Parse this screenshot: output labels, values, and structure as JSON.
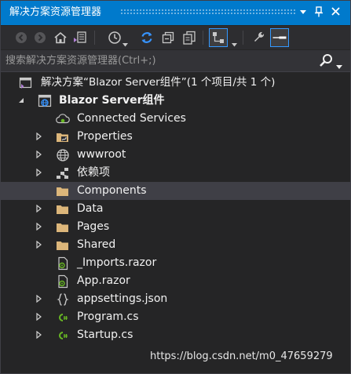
{
  "panel": {
    "title": "解决方案资源管理器",
    "controls": {
      "dropdown": "▼",
      "pin": "📌",
      "close": "✕"
    }
  },
  "toolbar": {
    "icons": [
      "back-icon",
      "forward-icon",
      "home-icon",
      "switch-views-icon",
      "pending-changes-filter-icon",
      "sync-icon",
      "collapse-all-icon",
      "show-all-files-icon",
      "properties-icon",
      "preview-icon"
    ]
  },
  "search": {
    "placeholder": "搜索解决方案资源管理器(Ctrl+;)",
    "value": ""
  },
  "tree": {
    "solution": "解决方案“Blazor Server组件”(1 个项目/共 1 个)",
    "project": "Blazor Server组件",
    "items": [
      {
        "label": "Connected Services",
        "icon": "connected-services-icon",
        "expandable": false
      },
      {
        "label": "Properties",
        "icon": "properties-folder-icon",
        "expandable": true
      },
      {
        "label": "wwwroot",
        "icon": "globe-icon",
        "expandable": true
      },
      {
        "label": "依赖项",
        "icon": "dependencies-icon",
        "expandable": true
      },
      {
        "label": "Components",
        "icon": "folder-icon",
        "expandable": false,
        "selected": true
      },
      {
        "label": "Data",
        "icon": "folder-icon",
        "expandable": true
      },
      {
        "label": "Pages",
        "icon": "folder-icon",
        "expandable": true
      },
      {
        "label": "Shared",
        "icon": "folder-icon",
        "expandable": true
      },
      {
        "label": "_Imports.razor",
        "icon": "razor-file-icon",
        "expandable": false
      },
      {
        "label": "App.razor",
        "icon": "razor-file-icon",
        "expandable": false
      },
      {
        "label": "appsettings.json",
        "icon": "json-file-icon",
        "expandable": true
      },
      {
        "label": "Program.cs",
        "icon": "csharp-file-icon",
        "expandable": true
      },
      {
        "label": "Startup.cs",
        "icon": "csharp-file-icon",
        "expandable": true
      }
    ]
  },
  "watermark": "https://blog.csdn.net/m0_47659279",
  "colors": {
    "accent": "#007acc",
    "background": "#252526",
    "selection": "#3f3f46",
    "folder": "#dcb67a",
    "csharp": "#68b723"
  }
}
